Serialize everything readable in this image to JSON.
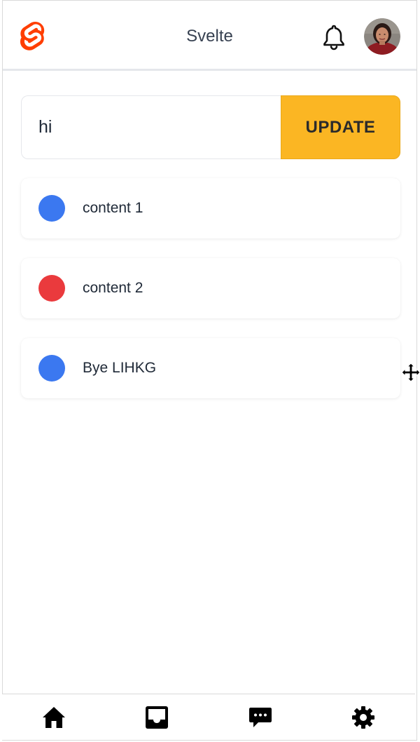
{
  "header": {
    "title": "Svelte",
    "logo_icon": "svelte-logo-icon",
    "notification_icon": "bell-icon",
    "avatar_icon": "user-avatar"
  },
  "form": {
    "input_value": "hi",
    "button_label": "UPDATE"
  },
  "list": {
    "items": [
      {
        "label": "content 1",
        "status_color": "#3b78f0"
      },
      {
        "label": "content 2",
        "status_color": "#ea3a3d"
      },
      {
        "label": "Bye LIHKG",
        "status_color": "#3b78f0"
      }
    ]
  },
  "nav": {
    "items": [
      {
        "icon": "home-icon"
      },
      {
        "icon": "inbox-icon"
      },
      {
        "icon": "chat-icon"
      },
      {
        "icon": "settings-gear-icon"
      }
    ]
  },
  "colors": {
    "accent": "#fbb623",
    "brand": "#ff3e00",
    "blue": "#3b78f0",
    "red": "#ea3a3d"
  }
}
